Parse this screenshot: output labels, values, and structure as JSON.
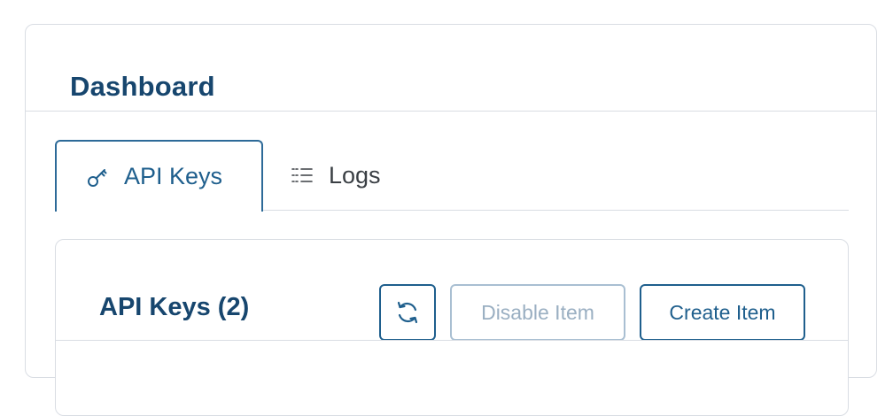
{
  "header": {
    "title": "Dashboard"
  },
  "tabs": [
    {
      "label": "API Keys",
      "icon": "key-icon",
      "active": true
    },
    {
      "label": "Logs",
      "icon": "list-icon",
      "active": false
    }
  ],
  "section": {
    "title": "API Keys (2)",
    "actions": {
      "refresh_icon": "refresh-icon",
      "disable_label": "Disable Item",
      "create_label": "Create Item"
    }
  },
  "colors": {
    "primary": "#1f5f8d",
    "title": "#17466e",
    "disabled": "#9aafc2",
    "border": "#d9dde3"
  }
}
